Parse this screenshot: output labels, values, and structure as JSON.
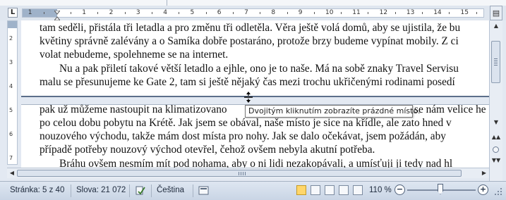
{
  "ruler": {
    "corner_label": "L",
    "numbers": [
      "1",
      "1",
      "2",
      "3",
      "4",
      "5",
      "6",
      "7",
      "8",
      "9",
      "10",
      "11",
      "12",
      "13",
      "14",
      "15"
    ]
  },
  "vertical_ruler": {
    "numbers": [
      "2",
      "3",
      "4",
      "5",
      "6",
      "7"
    ]
  },
  "document": {
    "lines": [
      "tam seděli, přistála tři letadla a pro změnu tři odletěla. Věra ještě volá domů, aby se ujistila, že bu",
      "květiny správně zalévány a o Samíka dobře postaráno, protože brzy budeme vypínat mobily. Z ci",
      "volat nebudeme, spolehneme se na internet.",
      "Nu a pak přiletí takové větší letadlo a ejhle, ono je to naše. Má na sobě znaky Travel Servisu",
      "malu se přesunujeme ke Gate 2, tam si ještě nějaký čas mezi trochu ukřičenými rodinami posedí",
      "pak už můžeme nastoupit na klimatizovano",
      "se nám velice he",
      "po celou dobu pobytu na Krétě. Jak jsem se obával, naše místo je sice na křídle, ale zato hned v",
      "nouzového východu, takže mám dost místa pro nohy. Jak se dalo očekávat, jsem požádán, aby",
      "případě potřeby nouzový východ otevřel, čehož ovšem nebyla akutní potřeba.",
      "Bráhu ovšem nesmím mít pod nohama, aby o ni lidi nezakopávali, a umísťuji ji tedy nad hl"
    ]
  },
  "tooltip": {
    "text": "Dvojitým kliknutím zobrazíte prázdné místo."
  },
  "statusbar": {
    "page": "Stránka: 5 z 40",
    "words": "Slova: 21 072",
    "language": "Čeština",
    "zoom": "110 %",
    "zoom_minus": "−",
    "zoom_plus": "+"
  },
  "icons": {
    "spellcheck": "spellcheck-icon",
    "macro": "macro-recording-icon",
    "views": [
      "print-layout-view-icon",
      "full-screen-reading-view-icon",
      "web-layout-view-icon",
      "outline-view-icon",
      "draft-view-icon"
    ]
  },
  "colors": {
    "margin_blue": "#9fb2c9",
    "statusbar": "#d5dfec",
    "active_view": "#ffd66a"
  }
}
